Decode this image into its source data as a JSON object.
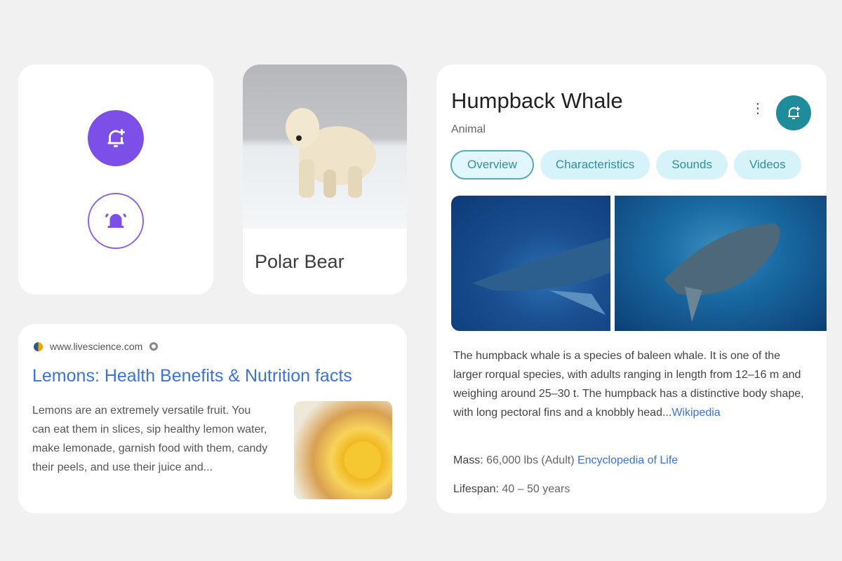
{
  "reminder_card": {
    "add_reminder_icon": "bell-plus-icon",
    "alarm_icon": "bell-ring-icon",
    "accent": "#7b4fe8"
  },
  "polar_bear_card": {
    "name": "Polar Bear"
  },
  "search_result": {
    "site": "www.livescience.com",
    "title": "Lemons: Health Benefits & Nutrition facts",
    "description": "Lemons are an extremely versatile fruit. You can eat them in slices, sip healthy lemon water, make lemonade, garnish food with them, candy their peels, and use their juice and..."
  },
  "knowledge_panel": {
    "title": "Humpback Whale",
    "subtitle": "Animal",
    "tabs": [
      {
        "label": "Overview",
        "active": true
      },
      {
        "label": "Characteristics"
      },
      {
        "label": "Sounds"
      },
      {
        "label": "Videos"
      }
    ],
    "description": "The humpback whale is a species of baleen whale. It is one of the larger rorqual species, with adults ranging in length from 12–16 m and weighing around 25–30 t. The humpback has a distinctive body shape, with long pectoral fins and a knobbly head...",
    "description_source": "Wikipedia",
    "mass_label": "Mass:",
    "mass_value": "66,000 lbs (Adult)",
    "mass_source": "Encyclopedia of Life",
    "lifespan_label": "Lifespan:",
    "lifespan_value": "40 – 50 years",
    "accent": "#1f8c9c"
  }
}
